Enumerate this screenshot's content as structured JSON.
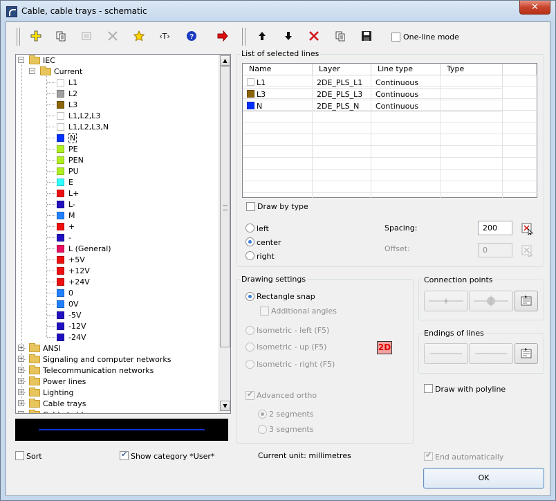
{
  "window": {
    "title": "Cable, cable trays - schematic",
    "close_label": "✕"
  },
  "toolbar": {
    "one_line_mode_label": "One-line mode",
    "one_line_mode_checked": false,
    "text_label": "‹T›"
  },
  "tree": {
    "root": "IEC",
    "current_folder": "Current",
    "selected": "N",
    "current_items": [
      {
        "label": "L1",
        "color": "#ffffff"
      },
      {
        "label": "L2",
        "color": "#a0a0a0"
      },
      {
        "label": "L3",
        "color": "#8b6508"
      },
      {
        "label": "L1,L2,L3",
        "color": "#ffffff"
      },
      {
        "label": "L1,L2,L3,N",
        "color": "#ffffff"
      },
      {
        "label": "N",
        "color": "#0030ff"
      },
      {
        "label": "PE",
        "color": "#b0f020"
      },
      {
        "label": "PEN",
        "color": "#b0f020"
      },
      {
        "label": "PU",
        "color": "#b0f020"
      },
      {
        "label": "E",
        "color": "#30ffff"
      },
      {
        "label": "L+",
        "color": "#ee1010"
      },
      {
        "label": "L-",
        "color": "#2010c0"
      },
      {
        "label": "M",
        "color": "#2080ff"
      },
      {
        "label": "+",
        "color": "#ee1010"
      },
      {
        "label": "-",
        "color": "#2010c0"
      },
      {
        "label": "L (General)",
        "color": "#e81060"
      },
      {
        "label": "+5V",
        "color": "#ee1010"
      },
      {
        "label": "+12V",
        "color": "#ee1010"
      },
      {
        "label": "+24V",
        "color": "#ee1010"
      },
      {
        "label": "0",
        "color": "#2080ff"
      },
      {
        "label": "0V",
        "color": "#2080ff"
      },
      {
        "label": "-5V",
        "color": "#2010c0"
      },
      {
        "label": "-12V",
        "color": "#2010c0"
      },
      {
        "label": "-24V",
        "color": "#2010c0"
      }
    ],
    "categories": [
      "ANSI",
      "Signaling and computer networks",
      "Telecommunication networks",
      "Power lines",
      "Lighting",
      "Cable trays",
      "Cable holders"
    ]
  },
  "selected_lines": {
    "group_label": "List of selected lines",
    "columns": [
      "Name",
      "Layer",
      "Line type",
      "Type"
    ],
    "rows": [
      {
        "name": "L1",
        "color": "#ffffff",
        "layer": "2DE_PLS_L1",
        "line_type": "Continuous",
        "type": ""
      },
      {
        "name": "L3",
        "color": "#8b6508",
        "layer": "2DE_PLS_L3",
        "line_type": "Continuous",
        "type": ""
      },
      {
        "name": "N",
        "color": "#0030ff",
        "layer": "2DE_PLS_N",
        "line_type": "Continuous",
        "type": ""
      }
    ],
    "draw_by_type_label": "Draw by type",
    "align_left_label": "left",
    "align_center_label": "center",
    "align_right_label": "right",
    "spacing_label": "Spacing:",
    "spacing_value": "200",
    "offset_label": "Offset:",
    "offset_value": "0"
  },
  "drawing_settings": {
    "group_label": "Drawing settings",
    "rectangle_snap_label": "Rectangle snap",
    "additional_angles_label": "Additional angles",
    "iso_left_label": "Isometric - left (F5)",
    "iso_up_label": "Isometric - up (F5)",
    "iso_right_label": "Isometric - right (F5)",
    "badge_2d": "2D",
    "advanced_ortho_label": "Advanced ortho",
    "two_segments_label": "2 segments",
    "three_segments_label": "3 segments"
  },
  "connection_points": {
    "group_label": "Connection points"
  },
  "endings": {
    "group_label": "Endings of lines"
  },
  "draw_polyline_label": "Draw with polyline",
  "footer": {
    "sort_label": "Sort",
    "show_category_label": "Show category *User*",
    "current_unit_label": "Current unit: millimetres",
    "end_automatically_label": "End automatically",
    "ok_label": "OK"
  }
}
